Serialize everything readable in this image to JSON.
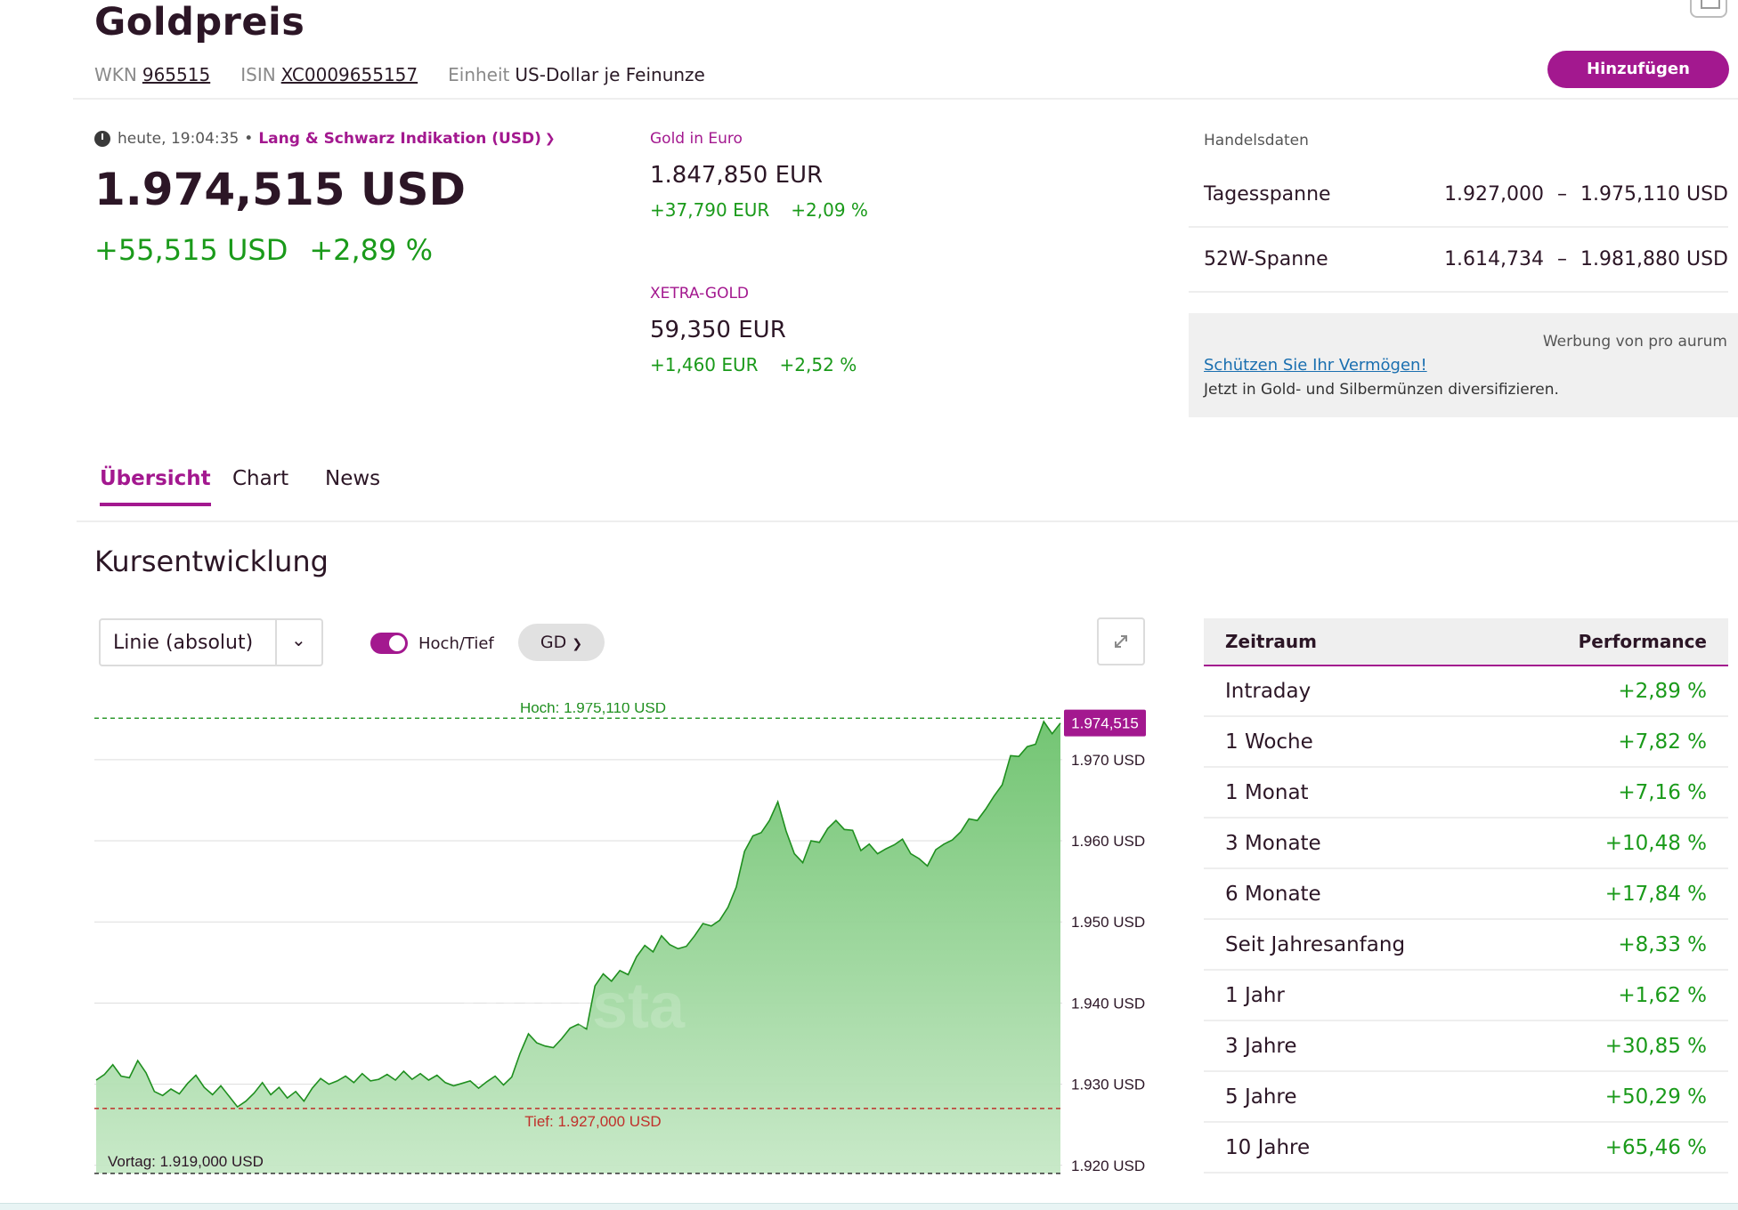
{
  "header": {
    "title": "Goldpreis",
    "wkn_label": "WKN",
    "wkn": "965515",
    "isin_label": "ISIN",
    "isin": "XC0009655157",
    "unit_label": "Einheit",
    "unit": "US-Dollar je Feinunze",
    "add_button": "Hinzufügen"
  },
  "quote": {
    "time": "heute, 19:04:35",
    "separator": "•",
    "source": "Lang & Schwarz Indikation (USD)",
    "price": "1.974,515 USD",
    "change_abs": "+55,515 USD",
    "change_pct": "+2,89 %"
  },
  "gold_euro": {
    "label": "Gold in Euro",
    "price": "1.847,850 EUR",
    "change_abs": "+37,790 EUR",
    "change_pct": "+2,09 %"
  },
  "xetra": {
    "label": "XETRA-GOLD",
    "price": "59,350 EUR",
    "change_abs": "+1,460 EUR",
    "change_pct": "+2,52 %"
  },
  "trading": {
    "label": "Handelsdaten",
    "rows": [
      {
        "label": "Tagesspanne",
        "low": "1.927,000",
        "dash": "–",
        "high": "1.975,110 USD"
      },
      {
        "label": "52W-Spanne",
        "low": "1.614,734",
        "dash": "–",
        "high": "1.981,880 USD"
      }
    ]
  },
  "ad": {
    "by": "Werbung von pro aurum",
    "link": "Schützen Sie Ihr Vermögen!",
    "text": "Jetzt in Gold- und Silbermünzen diversifizieren."
  },
  "tabs": [
    "Übersicht",
    "Chart",
    "News"
  ],
  "section_title": "Kursentwicklung",
  "chart_controls": {
    "select_value": "Linie (absolut)",
    "toggle_label": "Hoch/Tief",
    "chip": "GD",
    "toggle_on": true
  },
  "colors": {
    "accent": "#a3188f",
    "positive": "#1a9a1a",
    "low_line": "#c0302a"
  },
  "chart_data": {
    "type": "area",
    "ylim": [
      1918,
      1977
    ],
    "y_ticks": [
      1970,
      1960,
      1950,
      1940,
      1930,
      1920
    ],
    "y_tick_labels": [
      "1.970 USD",
      "1.960 USD",
      "1.950 USD",
      "1.940 USD",
      "1.930 USD",
      "1.920 USD"
    ],
    "high": 1975.11,
    "high_label": "Hoch: 1.975,110 USD",
    "low": 1927.0,
    "low_label": "Tief: 1.927,000 USD",
    "prev_close": 1919.0,
    "prev_close_label": "Vortag: 1.919,000 USD",
    "last": 1974.515,
    "last_label": "1.974,515",
    "watermark": "onvista",
    "series": [
      {
        "values": [
          1930.5,
          1931.2,
          1932.4,
          1931.0,
          1930.8,
          1932.9,
          1931.4,
          1929.1,
          1928.6,
          1929.4,
          1928.8,
          1930.1,
          1931.1,
          1929.6,
          1928.7,
          1929.8,
          1928.5,
          1927.2,
          1927.9,
          1928.9,
          1930.2,
          1928.7,
          1929.6,
          1928.3,
          1929.1,
          1927.9,
          1929.5,
          1930.7,
          1930.0,
          1930.4,
          1931.0,
          1930.2,
          1931.3,
          1930.4,
          1930.6,
          1931.2,
          1930.5,
          1931.6,
          1930.6,
          1931.3,
          1930.5,
          1931.1,
          1930.2,
          1929.8,
          1930.1,
          1930.4,
          1929.5,
          1930.3,
          1931.0,
          1929.9,
          1930.9,
          1933.8,
          1936.2,
          1935.1,
          1934.7,
          1934.5,
          1935.6,
          1936.9,
          1937.4,
          1936.8,
          1942.1,
          1943.6,
          1942.7,
          1944.0,
          1943.5,
          1945.7,
          1947.1,
          1946.3,
          1948.3,
          1947.2,
          1946.7,
          1947.0,
          1948.3,
          1949.8,
          1949.5,
          1950.2,
          1951.8,
          1954.3,
          1958.7,
          1960.6,
          1961.0,
          1962.5,
          1964.8,
          1961.2,
          1958.4,
          1957.3,
          1960.0,
          1959.8,
          1961.5,
          1962.5,
          1961.4,
          1961.3,
          1958.8,
          1959.6,
          1958.4,
          1959.0,
          1959.5,
          1960.2,
          1958.4,
          1957.8,
          1956.9,
          1958.9,
          1959.6,
          1960.1,
          1961.1,
          1962.7,
          1962.5,
          1963.9,
          1965.5,
          1966.9,
          1970.5,
          1970.4,
          1971.6,
          1971.9,
          1974.7,
          1973.2,
          1974.5
        ]
      }
    ]
  }
}
